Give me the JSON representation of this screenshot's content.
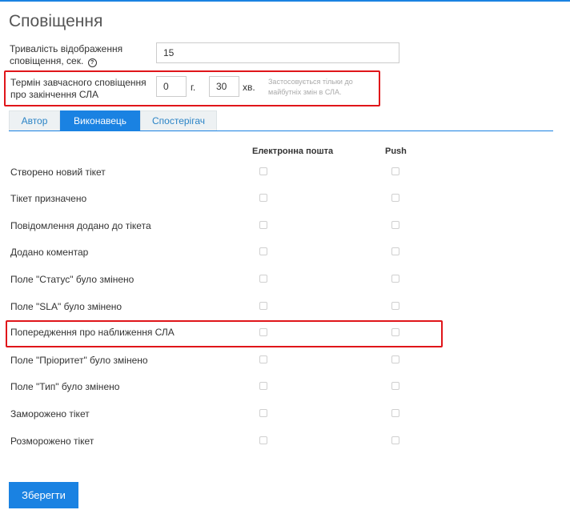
{
  "page_title": "Сповіщення",
  "display_duration": {
    "label_line1": "Тривалість відображення",
    "label_line2": "сповіщення, сек.",
    "help_icon": "?",
    "value": "15"
  },
  "sla_warning": {
    "label_line1": "Термін завчасного сповіщення",
    "label_line2": "про закінчення СЛА",
    "hours_value": "0",
    "hours_unit": "г.",
    "minutes_value": "30",
    "minutes_unit": "хв.",
    "hint_line1": "Застосовується тільки до",
    "hint_line2": "майбутніх змін в СЛА."
  },
  "tabs": [
    {
      "label": "Автор",
      "active": false
    },
    {
      "label": "Виконавець",
      "active": true
    },
    {
      "label": "Спостерігач",
      "active": false
    }
  ],
  "columns": {
    "email": "Електронна пошта",
    "push": "Push"
  },
  "events": [
    {
      "label": "Створено новий тікет",
      "email": false,
      "push": false
    },
    {
      "label": "Тікет призначено",
      "email": false,
      "push": false
    },
    {
      "label": "Повідомлення додано до тікета",
      "email": false,
      "push": false
    },
    {
      "label": "Додано коментар",
      "email": false,
      "push": false
    },
    {
      "label": "Поле \"Статус\" було змінено",
      "email": false,
      "push": false
    },
    {
      "label": "Поле \"SLA\" було змінено",
      "email": false,
      "push": false
    },
    {
      "label": "Попередження про наближення СЛА",
      "email": false,
      "push": false
    },
    {
      "label": "Поле \"Пріоритет\" було змінено",
      "email": false,
      "push": false
    },
    {
      "label": "Поле \"Тип\" було змінено",
      "email": false,
      "push": false
    },
    {
      "label": "Заморожено тікет",
      "email": false,
      "push": false
    },
    {
      "label": "Розморожено тікет",
      "email": false,
      "push": false
    }
  ],
  "save_button": "Зберегти",
  "colors": {
    "accent": "#1a82e2",
    "highlight": "#e0151a"
  }
}
